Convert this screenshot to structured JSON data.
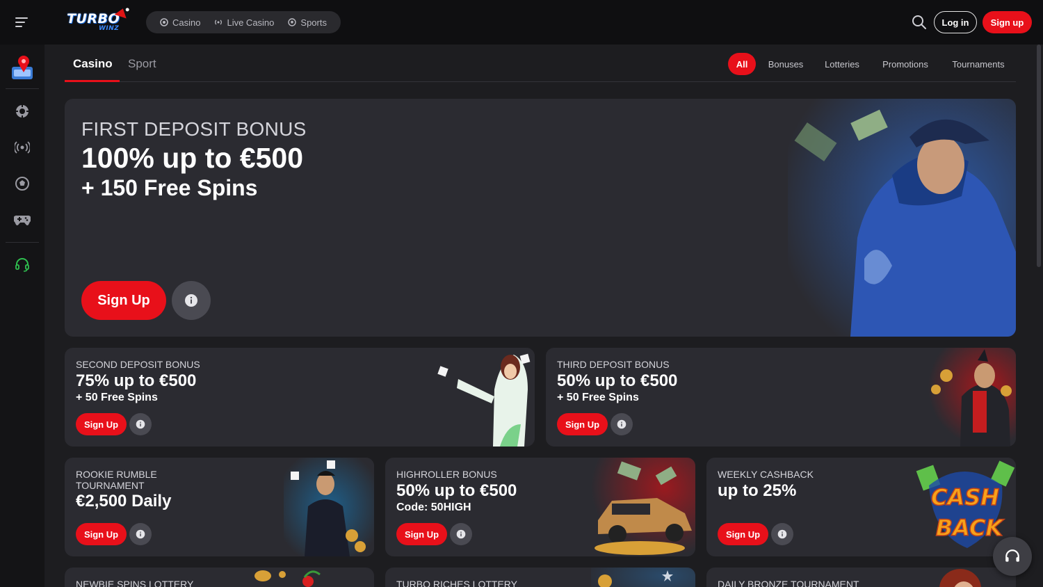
{
  "brand": {
    "logo_main": "TURBO",
    "logo_sub": "WINZ"
  },
  "header": {
    "nav": [
      {
        "label": "Casino",
        "icon": "casino-chip-icon"
      },
      {
        "label": "Live Casino",
        "icon": "broadcast-icon"
      },
      {
        "label": "Sports",
        "icon": "soccer-ball-icon"
      }
    ],
    "login_label": "Log in",
    "signup_label": "Sign up"
  },
  "sidebar": {
    "items": [
      {
        "icon": "promotions-icon"
      },
      {
        "icon": "casino-chip-icon"
      },
      {
        "icon": "broadcast-icon"
      },
      {
        "icon": "soccer-ball-icon"
      },
      {
        "icon": "gamepad-icon"
      },
      {
        "icon": "headset-icon"
      }
    ]
  },
  "tabs": {
    "casino": "Casino",
    "sport": "Sport"
  },
  "filters": {
    "all": "All",
    "bonuses": "Bonuses",
    "lotteries": "Lotteries",
    "promotions": "Promotions",
    "tournaments": "Tournaments"
  },
  "hero": {
    "kicker": "FIRST DEPOSIT BONUS",
    "title": "100% up to €500",
    "subtitle": "+ 150 Free Spins",
    "signup_label": "Sign Up"
  },
  "cards": [
    {
      "kicker": "SECOND DEPOSIT BONUS",
      "title": "75% up to €500",
      "subtitle": "+ 50 Free Spins",
      "signup_label": "Sign Up"
    },
    {
      "kicker": "THIRD DEPOSIT BONUS",
      "title": "50% up to €500",
      "subtitle": "+ 50 Free Spins",
      "signup_label": "Sign Up"
    },
    {
      "kicker": "ROOKIE RUMBLE TOURNAMENT",
      "kicker_line1": "ROOKIE RUMBLE",
      "kicker_line2": "TOURNAMENT",
      "title": "€2,500 Daily",
      "signup_label": "Sign Up"
    },
    {
      "kicker": "HIGHROLLER BONUS",
      "title": "50% up to €500",
      "subtitle": "Code: 50HIGH",
      "signup_label": "Sign Up"
    },
    {
      "kicker": "WEEKLY CASHBACK",
      "title": "up to 25%",
      "signup_label": "Sign Up",
      "art_text": "CASH BACK"
    },
    {
      "kicker": "NEWBIE SPINS LOTTERY"
    },
    {
      "kicker": "TURBO RICHES LOTTERY"
    },
    {
      "kicker": "DAILY BRONZE TOURNAMENT"
    }
  ],
  "colors": {
    "accent": "#e8101a",
    "background": "#1d1d20",
    "card": "#2b2b31",
    "support": "#2fbf4f"
  }
}
